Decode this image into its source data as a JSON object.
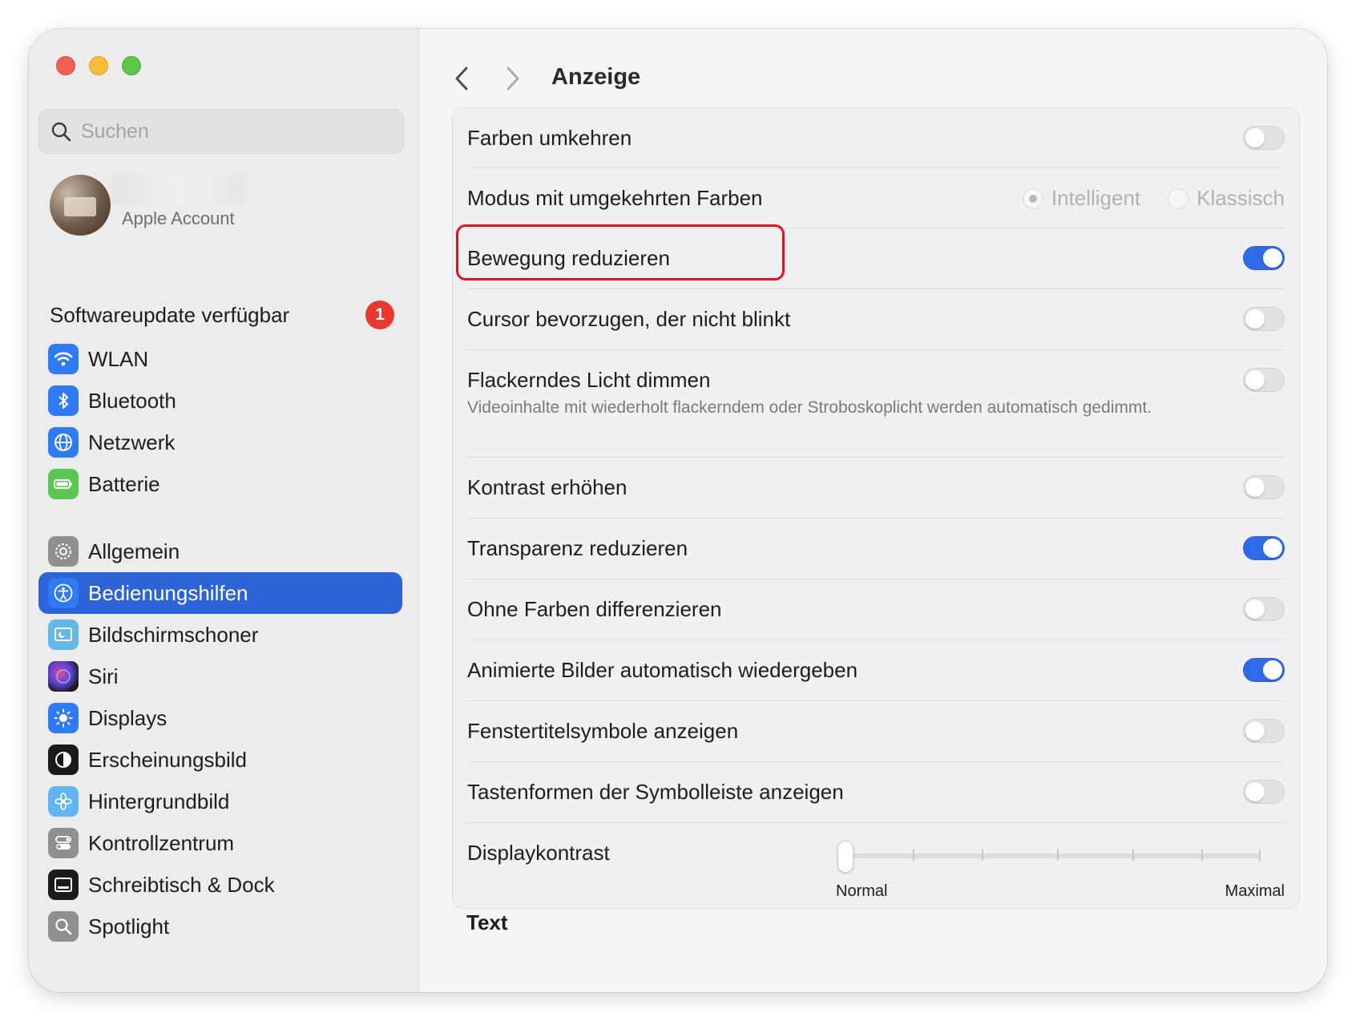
{
  "search": {
    "placeholder": "Suchen"
  },
  "account": {
    "subtitle": "Apple Account"
  },
  "update": {
    "label": "Softwareupdate verfügbar",
    "badge": "1"
  },
  "sidebar": {
    "items": [
      {
        "label": "WLAN",
        "icon": "wifi-icon",
        "color": "#2f7bf6"
      },
      {
        "label": "Bluetooth",
        "icon": "bluetooth-icon",
        "color": "#2f7bf6"
      },
      {
        "label": "Netzwerk",
        "icon": "globe-icon",
        "color": "#2f7bf6"
      },
      {
        "label": "Batterie",
        "icon": "battery-icon",
        "color": "#5cc653"
      },
      {
        "label": "Allgemein",
        "icon": "gear-icon",
        "color": "#8e8e93"
      },
      {
        "label": "Bedienungshilfen",
        "icon": "accessibility-icon",
        "color": "#2f7bf6",
        "selected": true
      },
      {
        "label": "Bildschirmschoner",
        "icon": "screensaver-icon",
        "color": "#62b8e8"
      },
      {
        "label": "Siri",
        "icon": "siri-icon",
        "color": "#1b1b1b"
      },
      {
        "label": "Displays",
        "icon": "sun-icon",
        "color": "#2f7bf6"
      },
      {
        "label": "Erscheinungsbild",
        "icon": "appearance-icon",
        "color": "#1b1b1b"
      },
      {
        "label": "Hintergrundbild",
        "icon": "flower-icon",
        "color": "#5fb6f0"
      },
      {
        "label": "Kontrollzentrum",
        "icon": "switches-icon",
        "color": "#8e8e93"
      },
      {
        "label": "Schreibtisch & Dock",
        "icon": "dock-icon",
        "color": "#1b1b1b"
      },
      {
        "label": "Spotlight",
        "icon": "magnifier-icon",
        "color": "#8e8e93"
      }
    ]
  },
  "header": {
    "title": "Anzeige"
  },
  "settings": {
    "invert_colors": {
      "label": "Farben umkehren",
      "on": false
    },
    "invert_mode": {
      "label": "Modus mit umgekehrten Farben",
      "option1": "Intelligent",
      "option2": "Klassisch",
      "selected": "Intelligent"
    },
    "reduce_motion": {
      "label": "Bewegung reduzieren",
      "on": true
    },
    "no_blink_cursor": {
      "label": "Cursor bevorzugen, der nicht blinkt",
      "on": false
    },
    "dim_flashing": {
      "label": "Flackerndes Licht dimmen",
      "desc": "Videoinhalte mit wiederholt flackerndem oder Stroboskoplicht werden automatisch gedimmt.",
      "on": false
    },
    "increase_contrast": {
      "label": "Kontrast erhöhen",
      "on": false
    },
    "reduce_transparency": {
      "label": "Transparenz reduzieren",
      "on": true
    },
    "differentiate_colors": {
      "label": "Ohne Farben differenzieren",
      "on": false
    },
    "autoplay_images": {
      "label": "Animierte Bilder automatisch wiedergeben",
      "on": true
    },
    "window_title_icons": {
      "label": "Fenstertitelsymbole anzeigen",
      "on": false
    },
    "toolbar_button_shapes": {
      "label": "Tastenformen der Symbolleiste anzeigen",
      "on": false
    },
    "display_contrast": {
      "label": "Displaykontrast",
      "min_label": "Normal",
      "max_label": "Maximal",
      "value": 0
    }
  },
  "section2": {
    "title": "Text"
  },
  "colors": {
    "accent": "#2d63d9",
    "toggle_on": "#2e6be6",
    "highlight": "#e0141e",
    "badge": "#e8382f"
  }
}
